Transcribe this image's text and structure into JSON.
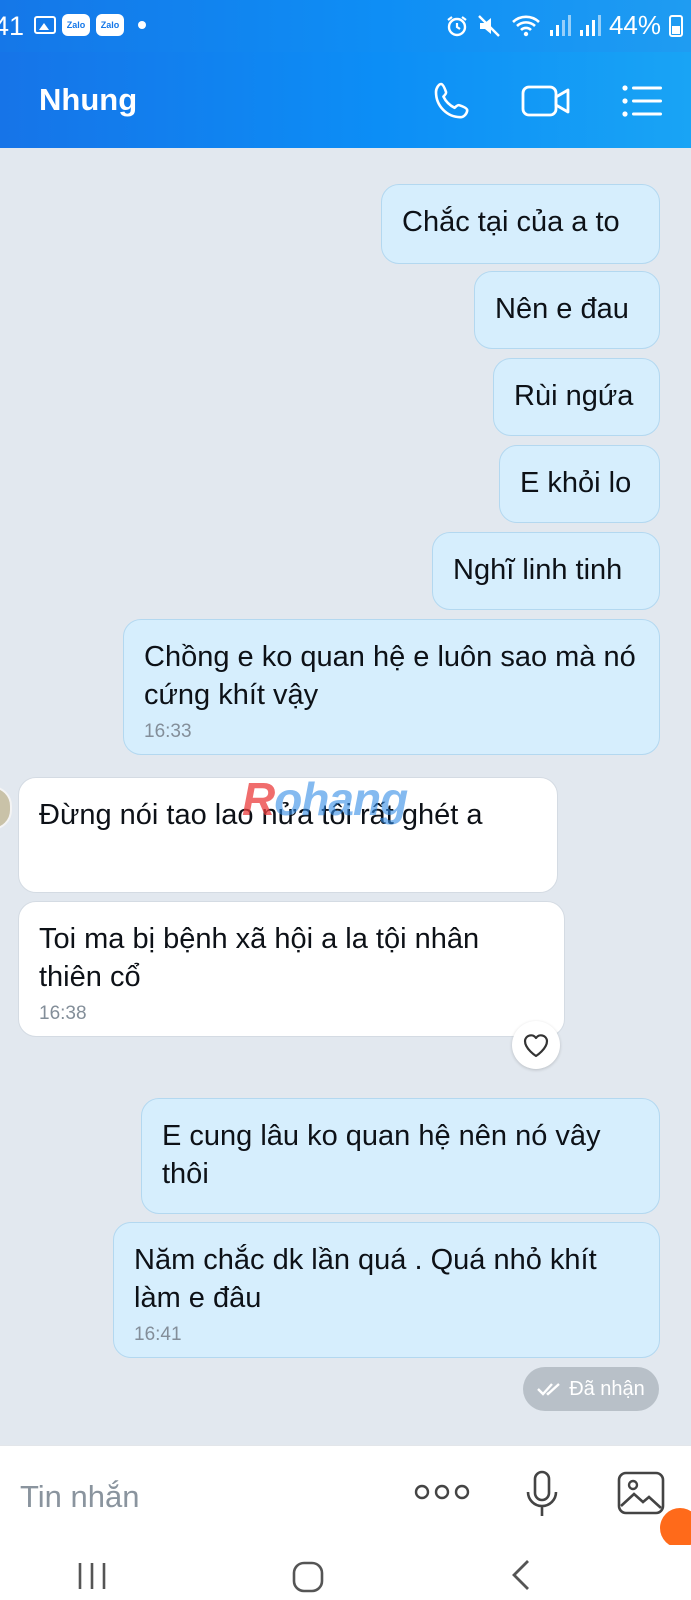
{
  "status_bar": {
    "time": "41",
    "battery": "44%",
    "icons": [
      "gallery-icon",
      "zalo-icon",
      "zalo-icon",
      "dot-icon",
      "alarm-icon",
      "mute-icon",
      "wifi-icon",
      "signal-icon",
      "signal-icon",
      "battery-icon"
    ]
  },
  "header": {
    "title": "Nhung",
    "actions": [
      "phone-icon",
      "video-call-icon",
      "menu-icon"
    ]
  },
  "messages": [
    {
      "dir": "out",
      "text": "Chắc tại của a to"
    },
    {
      "dir": "out",
      "text": "Nên e đau"
    },
    {
      "dir": "out",
      "text": "Rùi ngứa"
    },
    {
      "dir": "out",
      "text": "E khỏi lo"
    },
    {
      "dir": "out",
      "text": "Nghĩ linh tinh"
    },
    {
      "dir": "out",
      "text": "Chồng e ko quan hệ e luôn sao mà nó cứng khít vậy",
      "time": "16:33"
    },
    {
      "dir": "in",
      "text": "Đừng  nói  tao lao nửa  tôi rất ghét a"
    },
    {
      "dir": "in",
      "text": "Toi ma bị bệnh  xã hội  a la tội nhân thiên cổ",
      "time": "16:38"
    },
    {
      "dir": "out",
      "text": "E cung lâu ko quan hệ nên nó vây thôi"
    },
    {
      "dir": "out",
      "text": "Năm chắc dk lần quá . Quá nhỏ khít làm e đâu",
      "time": "16:41"
    }
  ],
  "received_status": "Đã nhận",
  "watermark": {
    "first": "R",
    "rest": "ohang"
  },
  "composer": {
    "placeholder": "Tin nhắn"
  },
  "colors": {
    "header_start": "#1674e8",
    "header_end": "#19a4f5",
    "outgoing_bubble": "#d6eefd",
    "incoming_bubble": "#ffffff",
    "chat_background": "#e2e8ef"
  }
}
